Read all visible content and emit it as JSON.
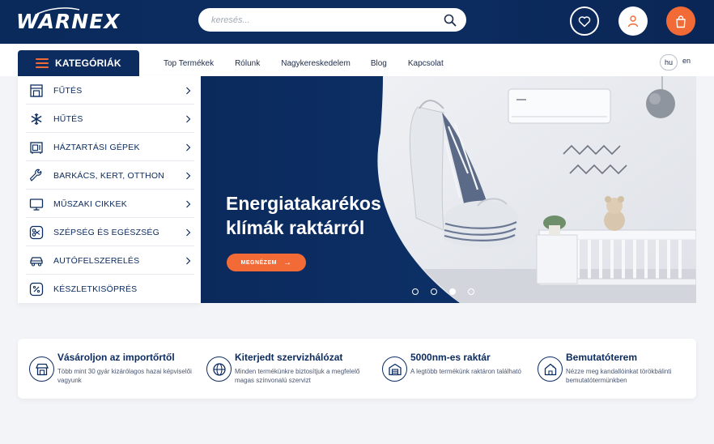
{
  "header": {
    "logo": "WARNEX",
    "search": {
      "placeholder": "keresés...",
      "value": ""
    },
    "icons": [
      "heart-icon",
      "user-icon",
      "cart-icon"
    ]
  },
  "nav": {
    "categories_label": "KATEGÓRIÁK",
    "links": [
      "Top Termékek",
      "Rólunk",
      "Nagykereskedelem",
      "Blog",
      "Kapcsolat"
    ],
    "languages": [
      "hu",
      "en"
    ]
  },
  "sidebar": {
    "items": [
      {
        "label": "FŰTÉS",
        "icon": "heater-icon",
        "has_submenu": true
      },
      {
        "label": "HŰTÉS",
        "icon": "snowflake-icon",
        "has_submenu": true
      },
      {
        "label": "HÁZTARTÁSI GÉPEK",
        "icon": "appliance-icon",
        "has_submenu": true
      },
      {
        "label": "BARKÁCS, KERT, OTTHON",
        "icon": "wrench-icon",
        "has_submenu": true
      },
      {
        "label": "MŰSZAKI CIKKEK",
        "icon": "monitor-icon",
        "has_submenu": true
      },
      {
        "label": "SZÉPSÉG ÉS EGÉSZSÉG",
        "icon": "scissors-icon",
        "has_submenu": true
      },
      {
        "label": "AUTÓFELSZERELÉS",
        "icon": "car-icon",
        "has_submenu": true
      },
      {
        "label": "KÉSZLETKISÖPRÉS",
        "icon": "percent-icon",
        "has_submenu": false
      }
    ]
  },
  "banner": {
    "title_line1": "Energiatakarékos",
    "title_line2": "klímák raktárról",
    "cta": "MEGNÉZEM",
    "slides": 4,
    "active_slide": 3
  },
  "features": [
    {
      "title": "Vásároljon az importőrtől",
      "desc": "Több mint 30 gyár kizárólagos hazai képviselői vagyunk",
      "icon": "store-icon"
    },
    {
      "title": "Kiterjedt szervizhálózat",
      "desc": "Minden termékünkre biztosítjuk a megfelelő magas színvonalú szervizt",
      "icon": "globe-icon"
    },
    {
      "title": "5000nm-es raktár",
      "desc": "A legtöbb termékünk raktáron található",
      "icon": "warehouse-icon"
    },
    {
      "title": "Bemutatóterem",
      "desc": "Nézze meg kandallóinkat törökbálinti bemutatótermünkben",
      "icon": "showroom-icon"
    }
  ],
  "colors": {
    "navy": "#0c2c60",
    "accent": "#f26a36",
    "background": "#f3f4f7"
  }
}
